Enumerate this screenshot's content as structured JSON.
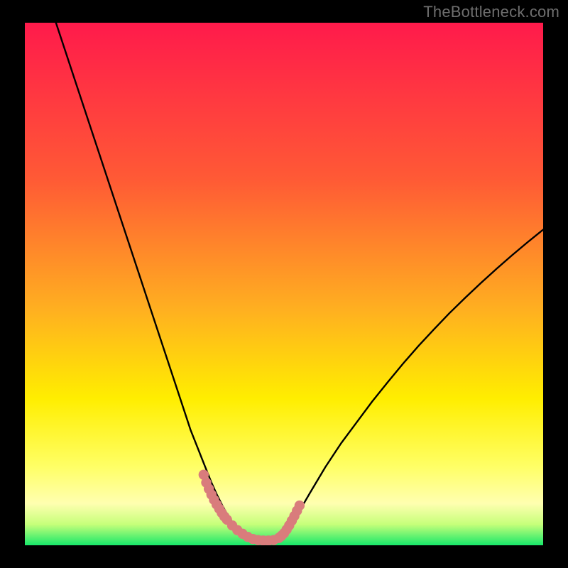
{
  "watermark": "TheBottleneck.com",
  "colors": {
    "background": "#000000",
    "watermark": "#6e6e6e",
    "grad_top": "#ff1a4b",
    "grad_orange": "#ff8a2a",
    "grad_yellow": "#ffee00",
    "grad_yellow_pale": "#ffff99",
    "grad_green": "#17e86a",
    "curve": "#000000",
    "marker": "#d97c7c"
  },
  "chart_data": {
    "type": "line",
    "title": "",
    "xlabel": "",
    "ylabel": "",
    "xlim": [
      0,
      100
    ],
    "ylim": [
      0,
      100
    ],
    "series": [
      {
        "name": "left-branch",
        "x": [
          6,
          8,
          10,
          12,
          14,
          16,
          18,
          20,
          22,
          24,
          26,
          28,
          30,
          32,
          34,
          35,
          36,
          37,
          38,
          39,
          40,
          41,
          42,
          43,
          44
        ],
        "values": [
          100,
          94,
          88,
          82,
          76,
          70,
          64,
          58,
          52,
          46,
          40,
          34,
          28,
          22,
          17,
          14.5,
          12,
          9.8,
          7.8,
          6.0,
          4.5,
          3.3,
          2.3,
          1.6,
          1.1
        ]
      },
      {
        "name": "right-branch",
        "x": [
          48,
          49,
          50,
          51,
          52,
          53,
          55,
          58,
          61,
          64,
          67,
          70,
          73,
          76,
          79,
          82,
          85,
          88,
          91,
          94,
          97,
          100
        ],
        "values": [
          1.2,
          1.7,
          2.5,
          3.6,
          5.0,
          6.6,
          10.0,
          15.0,
          19.5,
          23.5,
          27.5,
          31.2,
          34.8,
          38.2,
          41.4,
          44.5,
          47.4,
          50.2,
          52.9,
          55.5,
          58.0,
          60.4
        ]
      },
      {
        "name": "valley-floor",
        "x": [
          39,
          40,
          41,
          42,
          43,
          44,
          45,
          46,
          47,
          48,
          49,
          50,
          51
        ],
        "values": [
          6.0,
          4.5,
          3.3,
          2.3,
          1.6,
          1.1,
          0.9,
          0.9,
          0.9,
          1.2,
          1.7,
          2.5,
          3.6
        ]
      }
    ],
    "markers": {
      "name": "highlight-dots",
      "x": [
        34.5,
        35,
        35.5,
        36,
        36.5,
        37,
        37.5,
        38,
        38.5,
        39,
        40,
        41,
        42,
        43,
        44,
        45,
        46,
        47,
        48,
        49,
        49.5,
        50,
        50.5,
        51,
        51.5,
        52,
        52.5,
        53
      ],
      "values": [
        13.5,
        12.0,
        10.8,
        9.7,
        8.7,
        7.8,
        7.0,
        6.2,
        5.5,
        4.9,
        3.8,
        2.9,
        2.2,
        1.6,
        1.2,
        1.0,
        0.9,
        0.9,
        1.0,
        1.4,
        1.8,
        2.3,
        3.0,
        3.8,
        4.7,
        5.6,
        6.6,
        7.6
      ]
    },
    "gradient_bands": [
      {
        "y0": 100,
        "y1": 30,
        "from": "#ff1a4b",
        "to": "#ff8a2a"
      },
      {
        "y0": 30,
        "y1": 12,
        "from": "#ff8a2a",
        "to": "#ffee00"
      },
      {
        "y0": 12,
        "y1": 5,
        "from": "#ffee00",
        "to": "#ffff99"
      },
      {
        "y0": 5,
        "y1": 0,
        "from": "#ffff99",
        "to": "#17e86a"
      }
    ]
  }
}
